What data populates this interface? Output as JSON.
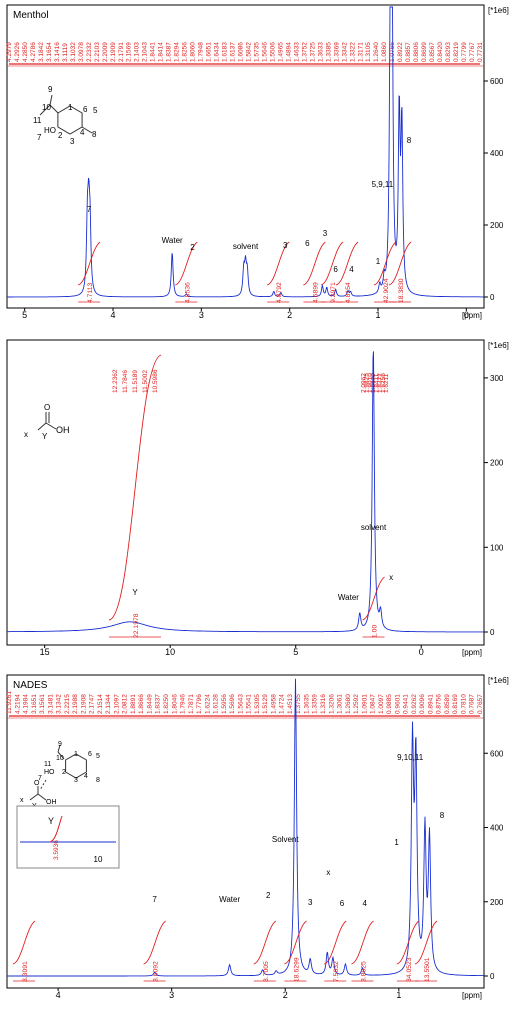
{
  "chart_data": [
    {
      "type": "line",
      "title": "Menthol",
      "x_unit": "[ppm]",
      "y_unit": "[*1e6]",
      "xlim": [
        5.2,
        -0.2
      ],
      "ylim": [
        -40,
        800
      ],
      "x_ticks": [
        5,
        4,
        3,
        2,
        1,
        0
      ],
      "y_ticks": [
        0,
        200,
        400,
        600
      ],
      "peaks": [
        {
          "ppm": 4.29,
          "height": 185
        },
        {
          "ppm": 4.275,
          "height": 195
        },
        {
          "ppm": 4.26,
          "height": 170
        },
        {
          "ppm": 3.33,
          "height": 125
        },
        {
          "ppm": 3.17,
          "height": 8
        },
        {
          "ppm": 2.52,
          "height": 70
        },
        {
          "ppm": 2.5,
          "height": 80
        },
        {
          "ppm": 2.48,
          "height": 65
        },
        {
          "ppm": 2.18,
          "height": 15
        },
        {
          "ppm": 2.1,
          "height": 12
        },
        {
          "ppm": 1.63,
          "height": 30
        },
        {
          "ppm": 1.58,
          "height": 25
        },
        {
          "ppm": 1.48,
          "height": 20
        },
        {
          "ppm": 1.34,
          "height": 15
        },
        {
          "ppm": 1.31,
          "height": 12
        },
        {
          "ppm": 0.98,
          "height": 25
        },
        {
          "ppm": 0.93,
          "height": 35
        },
        {
          "ppm": 0.86,
          "height": 790
        },
        {
          "ppm": 0.84,
          "height": 730
        },
        {
          "ppm": 0.76,
          "height": 490
        },
        {
          "ppm": 0.73,
          "height": 460
        }
      ],
      "integrals": [
        {
          "ppm": 4.27,
          "value": "4.7113"
        },
        {
          "ppm": 3.17,
          "value": "4.8536"
        },
        {
          "ppm": 2.13,
          "value": "4.8792"
        },
        {
          "ppm": 1.72,
          "value": "4.6899"
        },
        {
          "ppm": 1.52,
          "value": "9.2971"
        },
        {
          "ppm": 1.35,
          "value": "4.8154"
        },
        {
          "ppm": 0.92,
          "value": "42.9024"
        },
        {
          "ppm": 0.75,
          "value": "18.3830"
        }
      ],
      "peak_list": [
        "4.2979",
        "4.2926",
        "4.2850",
        "4.2786",
        "3.1842",
        "3.1654",
        "3.1416",
        "3.1119",
        "3.1032",
        "3.0978",
        "2.2332",
        "2.2103",
        "2.2009",
        "2.1909",
        "2.1791",
        "2.1569",
        "2.1403",
        "2.1043",
        "1.8441",
        "1.8414",
        "1.8387",
        "1.8294",
        "1.8256",
        "1.8060",
        "1.7948",
        "1.6651",
        "1.6434",
        "1.6183",
        "1.6137",
        "1.6086",
        "1.5842",
        "1.5735",
        "1.5646",
        "1.5506",
        "1.4965",
        "1.4894",
        "1.4633",
        "1.3752",
        "1.3725",
        "1.3633",
        "1.3385",
        "1.3369",
        "1.3342",
        "1.3322",
        "1.3171",
        "1.3105",
        "1.2640",
        "1.0860",
        "1.0766",
        "0.8922",
        "0.8857",
        "0.8806",
        "0.8699",
        "0.8567",
        "0.8420",
        "0.8293",
        "0.8219",
        "0.7799",
        "0.7767",
        "0.7731"
      ],
      "annotations": [
        {
          "text": "7",
          "ppm": 4.27
        },
        {
          "text": "Water",
          "ppm": 3.33
        },
        {
          "text": "2",
          "ppm": 3.1
        },
        {
          "text": "solvent",
          "ppm": 2.5
        },
        {
          "text": "3",
          "ppm": 2.05
        },
        {
          "text": "6",
          "ppm": 1.8
        },
        {
          "text": "3",
          "ppm": 1.6
        },
        {
          "text": "6",
          "ppm": 1.48
        },
        {
          "text": "4",
          "ppm": 1.3
        },
        {
          "text": "1",
          "ppm": 1.0
        },
        {
          "text": "5,9,11",
          "ppm": 0.95
        },
        {
          "text": "8",
          "ppm": 0.65
        }
      ],
      "structure_labels": [
        "9",
        "10",
        "1",
        "6",
        "5",
        "11",
        "7",
        "HO",
        "2",
        "3",
        "4",
        "8"
      ]
    },
    {
      "type": "line",
      "title": "",
      "x_unit": "[ppm]",
      "y_unit": "[*1e6]",
      "xlim": [
        16.5,
        -2.5
      ],
      "ylim": [
        -15,
        340
      ],
      "x_ticks": [
        15,
        10,
        5,
        0
      ],
      "y_ticks": [
        0,
        100,
        200,
        300
      ],
      "peaks": [
        {
          "ppm": 11.6,
          "height": 12
        },
        {
          "ppm": 2.45,
          "height": 20
        },
        {
          "ppm": 1.91,
          "height": 340
        },
        {
          "ppm": 1.62,
          "height": 20
        }
      ],
      "integrals": [
        {
          "ppm": 11.4,
          "value": "22.1978"
        },
        {
          "ppm": 1.9,
          "value": "1.00"
        }
      ],
      "peak_list_left": [
        "12.2362",
        "11.7846",
        "11.5189",
        "11.5002",
        "10.5986"
      ],
      "peak_list_right": [
        "2.0962",
        "1.9825",
        "1.9010",
        "1.8640",
        "1.8411",
        "1.8372",
        "1.6256",
        "1.6211"
      ],
      "annotations": [
        {
          "text": "Y",
          "ppm": 11.4
        },
        {
          "text": "solvent",
          "ppm": 1.9
        },
        {
          "text": "Water",
          "ppm": 2.9
        },
        {
          "text": "x",
          "ppm": 1.2
        }
      ],
      "structure_labels": [
        "x",
        "Y",
        "OH",
        "O"
      ]
    },
    {
      "type": "line",
      "title": "NADES",
      "x_unit": "[ppm]",
      "y_unit": "[*1e6]",
      "xlim": [
        4.45,
        0.25
      ],
      "ylim": [
        -40,
        800
      ],
      "x_ticks": [
        4,
        3,
        2,
        1
      ],
      "y_ticks": [
        0,
        200,
        400,
        600
      ],
      "peaks": [
        {
          "ppm": 3.15,
          "height": 10
        },
        {
          "ppm": 2.49,
          "height": 30
        },
        {
          "ppm": 2.2,
          "height": 15
        },
        {
          "ppm": 2.08,
          "height": 10
        },
        {
          "ppm": 1.91,
          "height": 800
        },
        {
          "ppm": 1.78,
          "height": 40
        },
        {
          "ppm": 1.63,
          "height": 60
        },
        {
          "ppm": 1.58,
          "height": 45
        },
        {
          "ppm": 1.47,
          "height": 30
        },
        {
          "ppm": 1.32,
          "height": 20
        },
        {
          "ppm": 0.88,
          "height": 600
        },
        {
          "ppm": 0.85,
          "height": 560
        },
        {
          "ppm": 0.77,
          "height": 380
        },
        {
          "ppm": 0.73,
          "height": 360
        }
      ],
      "integrals": [
        {
          "ppm": 4.3,
          "value": "3.3091"
        },
        {
          "ppm": 3.15,
          "value": "3.6092"
        },
        {
          "ppm": 2.18,
          "value": "3.7005"
        },
        {
          "ppm": 1.91,
          "value": "18.6299"
        },
        {
          "ppm": 1.56,
          "value": "7.5032"
        },
        {
          "ppm": 1.32,
          "value": "3.8025"
        },
        {
          "ppm": 0.92,
          "value": "34.0523"
        },
        {
          "ppm": 0.76,
          "value": "13.5501"
        }
      ],
      "peak_list": [
        "11.9261",
        "4.2194",
        "4.1984",
        "3.1651",
        "3.1561",
        "3.1481",
        "3.1342",
        "2.2215",
        "2.1988",
        "2.1908",
        "2.1747",
        "2.1514",
        "2.1344",
        "2.1097",
        "2.0812",
        "1.8891",
        "1.8666",
        "1.8449",
        "1.8337",
        "1.8250",
        "1.8046",
        "1.7946",
        "1.7871",
        "1.7796",
        "1.6224",
        "1.6128",
        "1.5956",
        "1.5696",
        "1.5643",
        "1.5541",
        "1.5395",
        "1.5129",
        "1.4958",
        "1.4724",
        "1.4513",
        "1.3755",
        "1.3635",
        "1.3359",
        "1.3316",
        "1.3206",
        "1.3061",
        "1.2680",
        "1.2592",
        "1.0901",
        "1.0847",
        "1.0097",
        "0.9885",
        "0.9601",
        "0.9441",
        "0.9262",
        "0.9096",
        "0.8941",
        "0.8756",
        "0.8589",
        "0.8169",
        "0.7810",
        "0.7687",
        "0.7657"
      ],
      "annotations": [
        {
          "text": "7",
          "ppm": 3.15
        },
        {
          "text": "Water",
          "ppm": 2.49
        },
        {
          "text": "2",
          "ppm": 2.15
        },
        {
          "text": "Solvent",
          "ppm": 2.0
        },
        {
          "text": "3",
          "ppm": 1.78
        },
        {
          "text": "x",
          "ppm": 1.62
        },
        {
          "text": "6",
          "ppm": 1.5
        },
        {
          "text": "4",
          "ppm": 1.3
        },
        {
          "text": "1",
          "ppm": 1.02
        },
        {
          "text": "9,10,11",
          "ppm": 0.9
        },
        {
          "text": "8",
          "ppm": 0.62
        }
      ],
      "inset": {
        "label": "Y",
        "integral": "3.5936",
        "tick": "10"
      },
      "structure_labels": [
        "9",
        "10",
        "1",
        "6",
        "5",
        "11",
        "7",
        "HO",
        "2",
        "3",
        "4",
        "8",
        "x",
        "Y",
        "O",
        "OH"
      ]
    }
  ]
}
